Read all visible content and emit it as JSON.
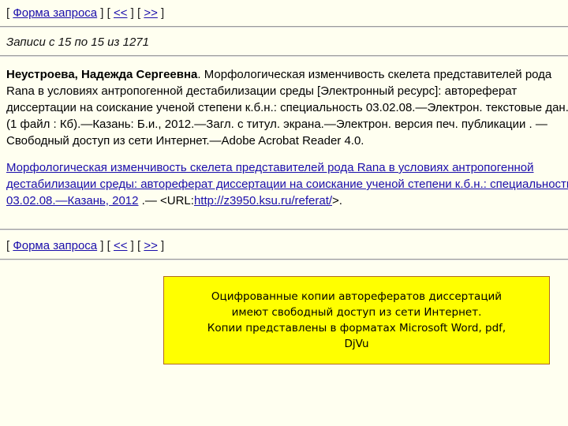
{
  "nav": {
    "bracket_open": "[ ",
    "form_link": "Форма запроса",
    "sep1": " ] [ ",
    "prev_link": "<<",
    "sep2": " ] [ ",
    "next_link": ">>",
    "bracket_close": " ]"
  },
  "records": {
    "count_text": "Записи с 15 по 15 из 1271"
  },
  "record": {
    "author": "Неустроева, Надежда Сергеевна",
    "lines": [
      ". Морфологическая изменчивость скелета представителей рода",
      "Rana в условиях антропогенной дестабилизации среды [Электронный ресурс]: автореферат",
      "диссертации на соискание ученой степени к.б.н.: специальность 03.02.08.—Электрон. текстовые дан.",
      "(1 файл : Кб).—Казань: Б.и., 2012.—Загл. с титул. экрана.—Электрон. версия печ. публикации . —",
      "Свободный доступ из сети Интернет.—Adobe Acrobat Reader 4.0."
    ]
  },
  "link": {
    "title_lines": [
      "Морфологическая изменчивость скелета представителей рода Rana в условиях антропогенной",
      "дестабилизации среды: автореферат диссертации на соискание ученой степени к.б.н.: специальность",
      "03.02.08.—Казань, 2012"
    ],
    "after_title": " .— <URL:",
    "url": "http://z3950.ksu.ru/referat/",
    "after_url": ">."
  },
  "notice": {
    "lines": [
      "Оцифрованные  копии  авторефератов диссертаций",
      "имеют  свободный  доступ  из  сети  Интернет.",
      "Копии представлены  в  форматах Microsoft  Word,  pdf,",
      "DjVu"
    ]
  }
}
